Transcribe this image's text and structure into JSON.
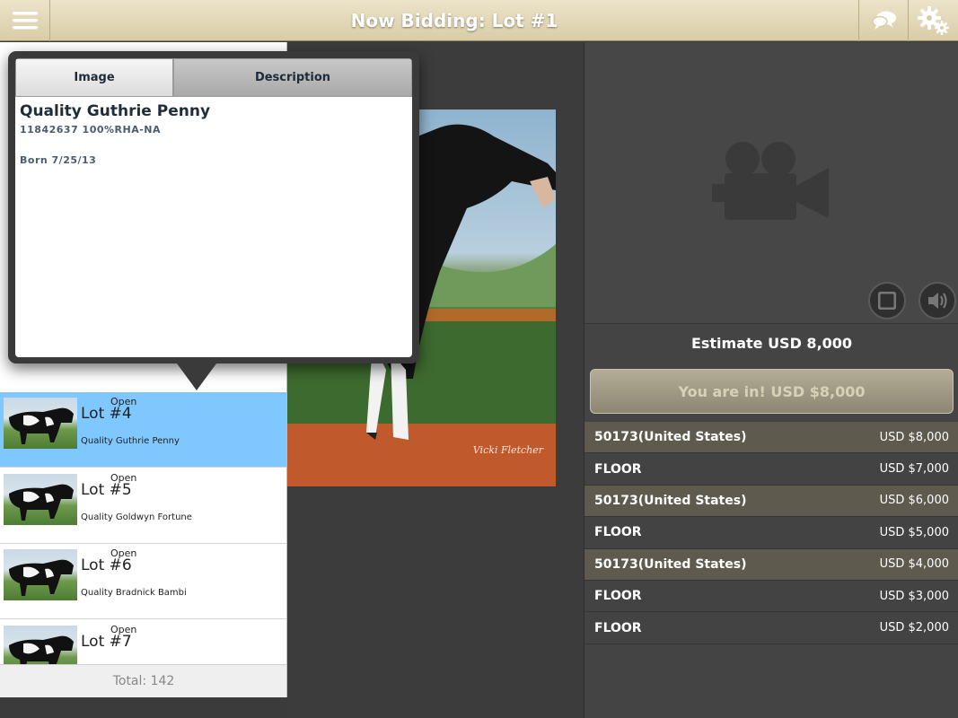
{
  "topbar": {
    "title": "Now Bidding: Lot #1",
    "menu_icon": "hamburger-menu-icon",
    "chat_icon": "chat-bubbles-icon",
    "settings_icon": "gear-icon"
  },
  "popover": {
    "tabs": [
      {
        "label": "Image",
        "selected": true
      },
      {
        "label": "Description",
        "selected": false
      }
    ],
    "lot_name": "Quality Guthrie Penny",
    "registration": "11842637 100%RHA-NA",
    "born": "Born 7/25/13"
  },
  "lots": [
    {
      "status": "Open",
      "number": "Lot #4",
      "name": "Quality Guthrie Penny",
      "selected": true
    },
    {
      "status": "Open",
      "number": "Lot #5",
      "name": "Quality Goldwyn Fortune",
      "selected": false
    },
    {
      "status": "Open",
      "number": "Lot #6",
      "name": "Quality Bradnick Bambi",
      "selected": false
    },
    {
      "status": "Open",
      "number": "Lot #7",
      "name": "",
      "selected": false
    }
  ],
  "list_total": "Total: 142",
  "photo": {
    "signature": "Vicki Fletcher"
  },
  "right_panel": {
    "video_icon": "video-camera-icon",
    "stop_icon": "stop-icon",
    "sound_icon": "speaker-icon",
    "estimate": "Estimate USD 8,000",
    "bid_status": "You are in! USD $8,000"
  },
  "bids": [
    {
      "bidder": "50173(United States)",
      "amount": "USD $8,000",
      "type": "online"
    },
    {
      "bidder": "FLOOR",
      "amount": "USD $7,000",
      "type": "floor"
    },
    {
      "bidder": "50173(United States)",
      "amount": "USD $6,000",
      "type": "online"
    },
    {
      "bidder": "FLOOR",
      "amount": "USD $5,000",
      "type": "floor"
    },
    {
      "bidder": "50173(United States)",
      "amount": "USD $4,000",
      "type": "online"
    },
    {
      "bidder": "FLOOR",
      "amount": "USD $3,000",
      "type": "floor"
    },
    {
      "bidder": "FLOOR",
      "amount": "USD $2,000",
      "type": "floor"
    }
  ],
  "colors": {
    "topbar": "#e3d8b8",
    "selected_lot": "#7fc8ff",
    "online_bid_row": "#5f5a4e",
    "floor_bid_row": "#434343"
  }
}
